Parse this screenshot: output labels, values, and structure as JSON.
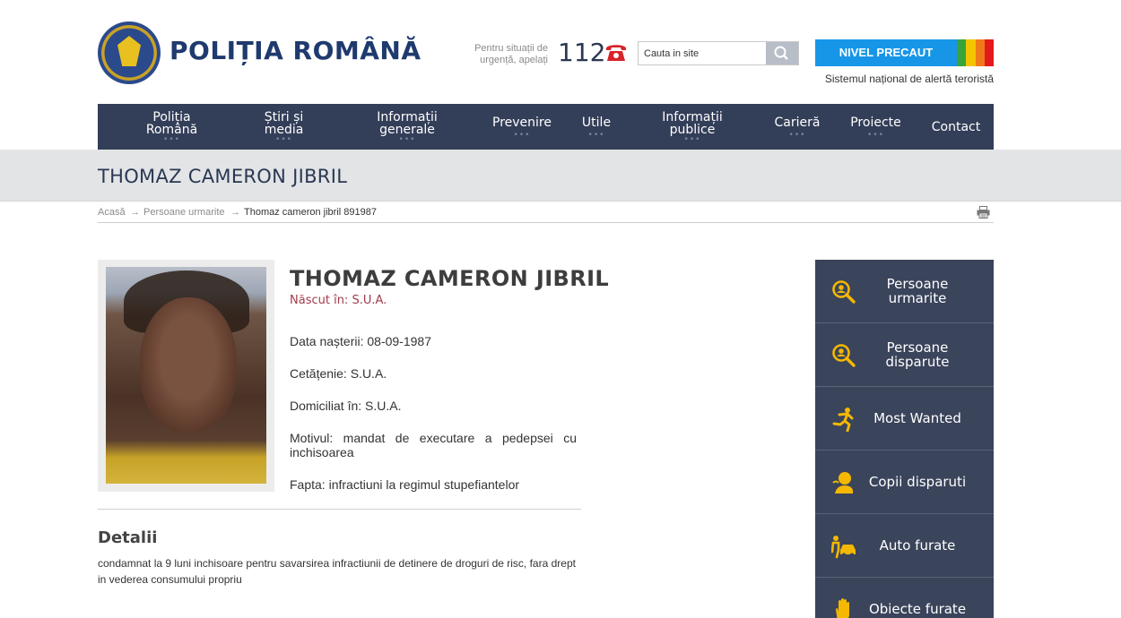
{
  "header": {
    "brand": "POLIȚIA ROMÂNĂ",
    "emergency_text_line1": "Pentru situații de",
    "emergency_text_line2": "urgență, apelați",
    "emergency_number": "112",
    "search_placeholder": "Cauta in site",
    "alert_level": "NIVEL PRECAUT",
    "alert_colors": [
      "#3aa33a",
      "#f2c500",
      "#f07a1a",
      "#e3191b"
    ],
    "alert_subtitle": "Sistemul național de alertă teroristă"
  },
  "nav": {
    "items": [
      {
        "line1": "Poliția",
        "line2": "Română",
        "dots": "•••"
      },
      {
        "line1": "Știri și",
        "line2": "media",
        "dots": "•••"
      },
      {
        "line1": "Informații",
        "line2": "generale",
        "dots": "•••"
      },
      {
        "line1": "Prevenire",
        "line2": "",
        "dots": "•••"
      },
      {
        "line1": "Utile",
        "line2": "",
        "dots": "•••"
      },
      {
        "line1": "Informații",
        "line2": "publice",
        "dots": "•••"
      },
      {
        "line1": "Carieră",
        "line2": "",
        "dots": "•••"
      },
      {
        "line1": "Proiecte",
        "line2": "",
        "dots": "•••"
      },
      {
        "line1": "Contact",
        "line2": "",
        "dots": ""
      }
    ]
  },
  "page": {
    "title": "THOMAZ CAMERON JIBRIL"
  },
  "breadcrumb": {
    "home": "Acasă",
    "section": "Persoane urmarite",
    "current": "Thomaz cameron jibril 891987",
    "separator": "→"
  },
  "person": {
    "name": "THOMAZ CAMERON JIBRIL",
    "born": "Născut în: S.U.A.",
    "birth_date": "Data nașterii: 08-09-1987",
    "citizenship": "Cetățenie: S.U.A.",
    "domicile": "Domiciliat în: S.U.A.",
    "reason": "Motivul: mandat de executare a pedepsei cu inchisoarea",
    "offense": "Fapta: infractiuni la regimul stupefiantelor"
  },
  "details": {
    "title": "Detalii",
    "text": "condamnat la 9 luni inchisoare pentru savarsirea infractiunii de detinere de droguri de risc, fara drept in vederea consumului propriu"
  },
  "sidebar": {
    "icon_color": "#f5b800",
    "items": [
      {
        "label": "Persoane urmarite",
        "icon": "magnifier-person-icon"
      },
      {
        "label": "Persoane disparute",
        "icon": "magnifier-person-icon"
      },
      {
        "label": "Most Wanted",
        "icon": "running-person-icon"
      },
      {
        "label": "Copii disparuti",
        "icon": "child-icon"
      },
      {
        "label": "Auto furate",
        "icon": "car-thief-icon"
      },
      {
        "label": "Obiecte furate",
        "icon": "hand-icon"
      }
    ]
  }
}
